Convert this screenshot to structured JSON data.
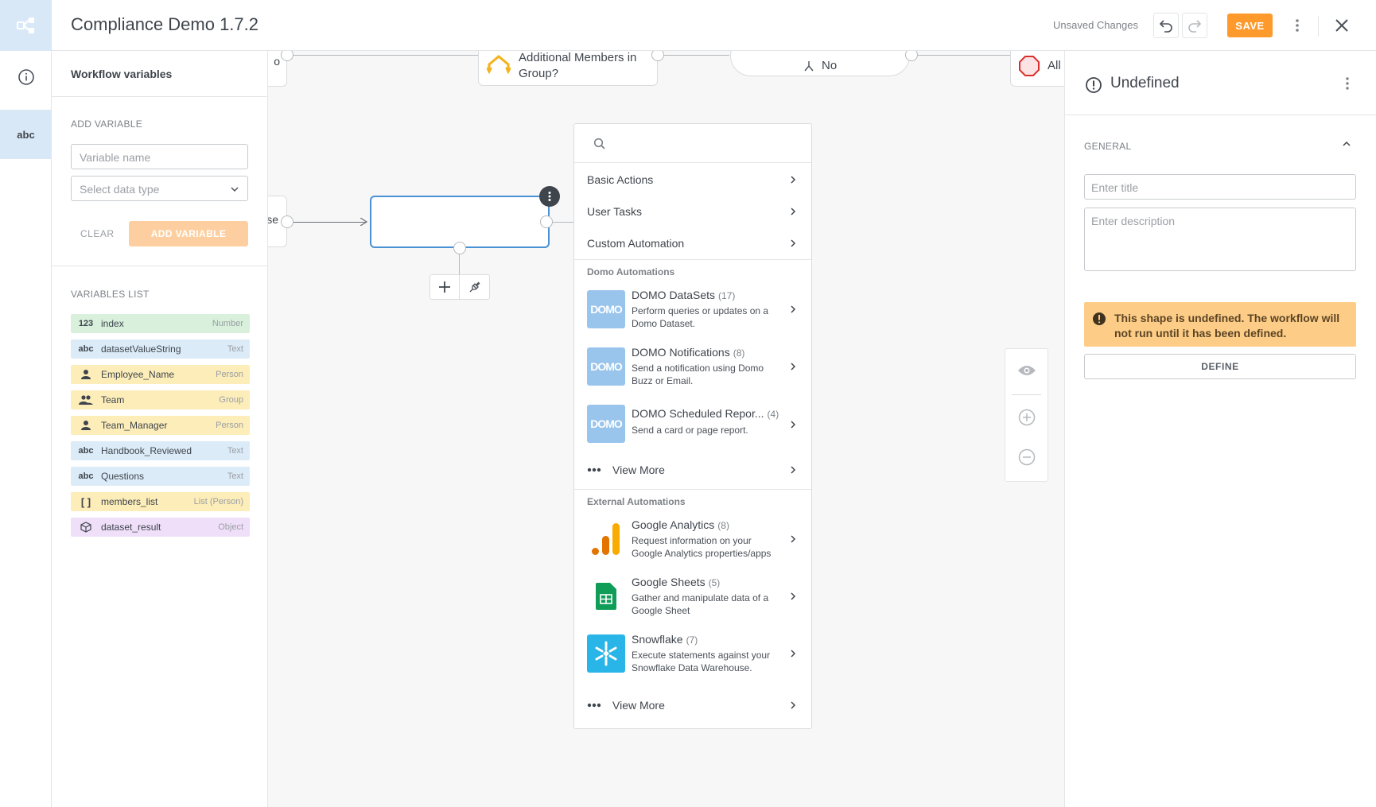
{
  "header": {
    "title": "Compliance Demo 1.7.2",
    "unsaved": "Unsaved Changes",
    "save_label": "SAVE"
  },
  "var_panel": {
    "title": "Workflow variables",
    "add_label": "ADD VARIABLE",
    "name_placeholder": "Variable name",
    "type_placeholder": "Select data type",
    "clear_label": "CLEAR",
    "add_button_label": "ADD VARIABLE",
    "list_label": "VARIABLES LIST",
    "variables": [
      {
        "icon": "123",
        "name": "index",
        "type": "Number"
      },
      {
        "icon": "abc",
        "name": "datasetValueString",
        "type": "Text"
      },
      {
        "icon": "person",
        "name": "Employee_Name",
        "type": "Person"
      },
      {
        "icon": "group",
        "name": "Team",
        "type": "Group"
      },
      {
        "icon": "person",
        "name": "Team_Manager",
        "type": "Person"
      },
      {
        "icon": "abc",
        "name": "Handbook_Reviewed",
        "type": "Text"
      },
      {
        "icon": "abc",
        "name": "Questions",
        "type": "Text"
      },
      {
        "icon": "[ ]",
        "name": "members_list",
        "type": "List (Person)"
      },
      {
        "icon": "cube",
        "name": "dataset_result",
        "type": "Object"
      }
    ]
  },
  "canvas": {
    "node_gateway_label": "Additional Members in Group?",
    "node_no_label": "No",
    "node_end_label": "All",
    "node_partial_label": "se",
    "node_top_left_partial": "o"
  },
  "menu": {
    "basic": [
      "Basic Actions",
      "User Tasks",
      "Custom Automation"
    ],
    "domo_group": "Domo Automations",
    "domo": [
      {
        "title": "DOMO DataSets",
        "count": "(17)",
        "desc": "Perform queries or updates on a Domo Dataset.",
        "logo_text": "DOMO"
      },
      {
        "title": "DOMO Notifications",
        "count": "(8)",
        "desc": "Send a notification using Domo Buzz or Email.",
        "logo_text": "DOMO"
      },
      {
        "title": "DOMO Scheduled Repor...",
        "count": "(4)",
        "desc": "Send a card or page report.",
        "logo_text": "DOMO"
      }
    ],
    "view_more": "View More",
    "external_group": "External Automations",
    "external": [
      {
        "title": "Google Analytics",
        "count": "(8)",
        "desc": "Request information on your Google Analytics properties/apps"
      },
      {
        "title": "Google Sheets",
        "count": "(5)",
        "desc": "Gather and manipulate data of a Google Sheet"
      },
      {
        "title": "Snowflake",
        "count": "(7)",
        "desc": "Execute statements against your Snowflake Data Warehouse."
      }
    ],
    "view_more_2": "View More"
  },
  "right_panel": {
    "title": "Undefined",
    "general_label": "GENERAL",
    "title_placeholder": "Enter title",
    "desc_placeholder": "Enter description",
    "warning": "This shape is undefined. The workflow will not run until it has been defined.",
    "define_label": "DEFINE"
  },
  "colors": {
    "accent": "#fd9a2b",
    "rail_active": "#99c4ec",
    "warning_bg": "#fdcd87"
  }
}
